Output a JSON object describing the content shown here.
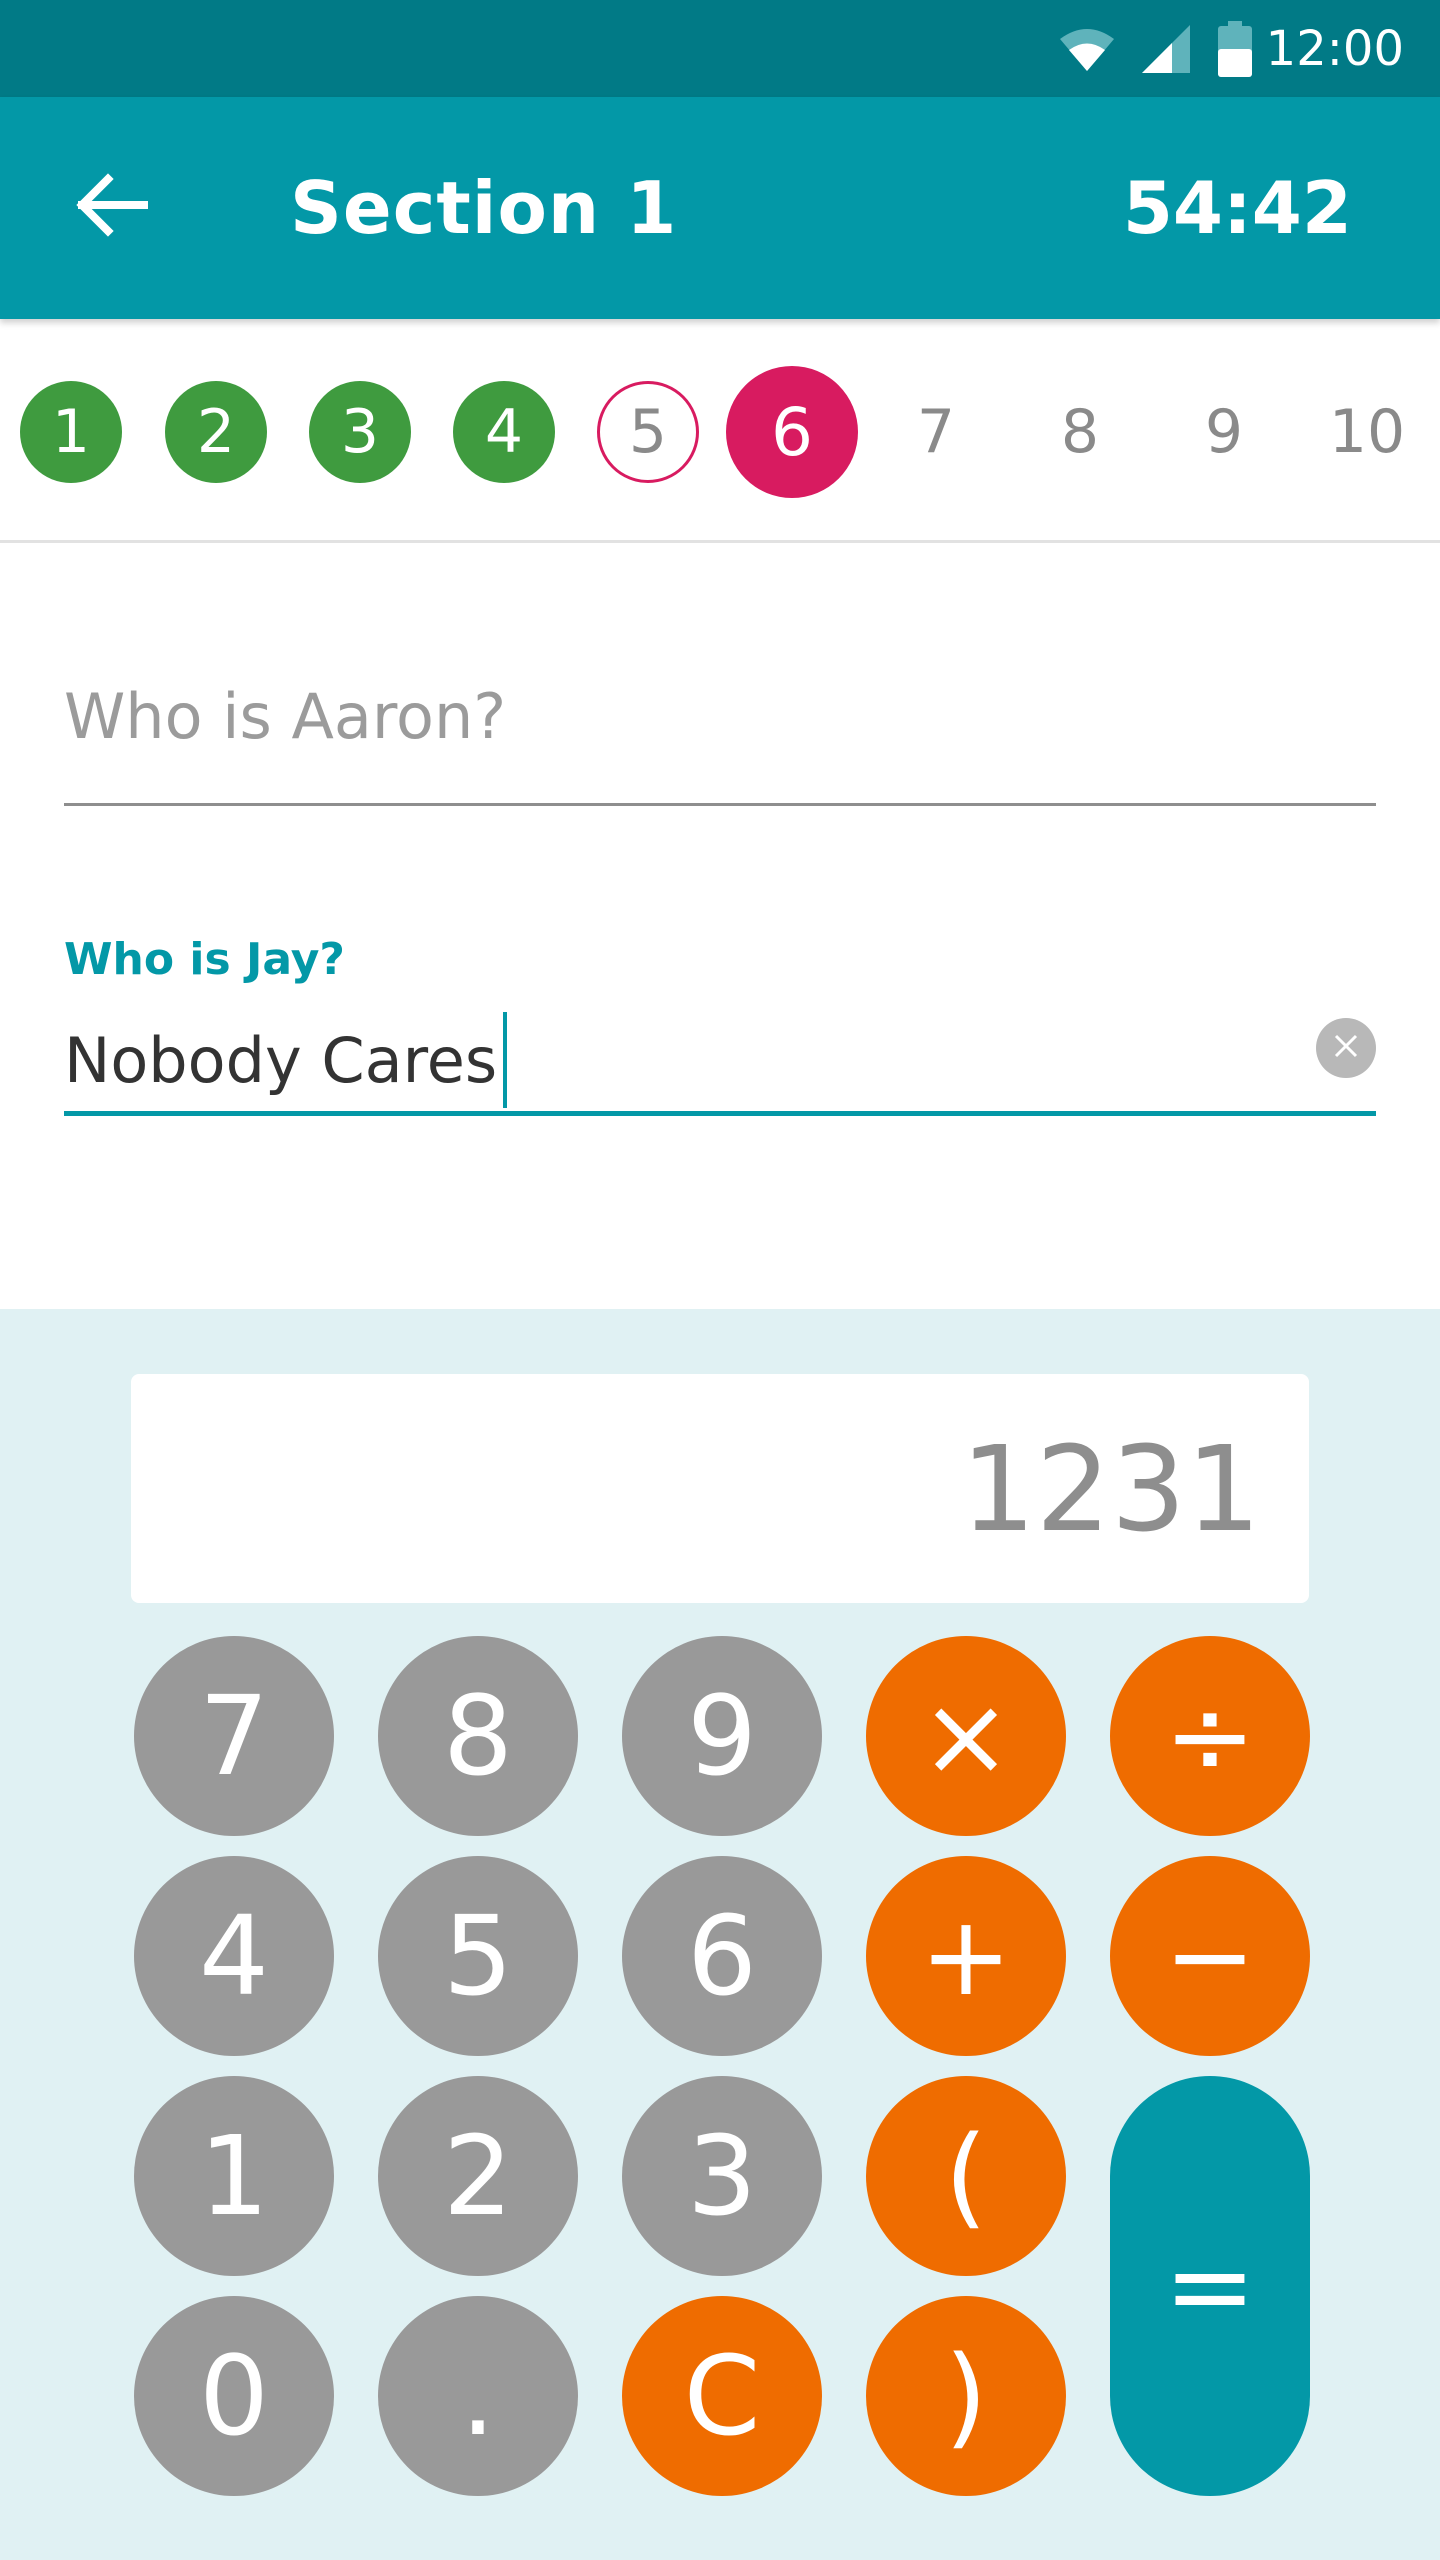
{
  "status_bar": {
    "time": "12:00",
    "icons": [
      "wifi-icon",
      "cell-signal-icon",
      "battery-icon"
    ]
  },
  "app_bar": {
    "back_icon": "arrow-left-icon",
    "title": "Section 1",
    "timer": "54:42"
  },
  "question_nav": {
    "items": [
      {
        "label": "1",
        "state": "answered"
      },
      {
        "label": "2",
        "state": "answered"
      },
      {
        "label": "3",
        "state": "answered"
      },
      {
        "label": "4",
        "state": "answered"
      },
      {
        "label": "5",
        "state": "flagged"
      },
      {
        "label": "6",
        "state": "current"
      },
      {
        "label": "7",
        "state": "unvisited"
      },
      {
        "label": "8",
        "state": "unvisited"
      },
      {
        "label": "9",
        "state": "unvisited"
      },
      {
        "label": "10",
        "state": "unvisited"
      }
    ]
  },
  "form": {
    "question1_placeholder": "Who is Aaron?",
    "question2_label": "Who is Jay?",
    "question2_value": "Nobody Cares",
    "clear_icon": "clear-circle-icon"
  },
  "calculator": {
    "display": "1231",
    "keys": {
      "k7": "7",
      "k8": "8",
      "k9": "9",
      "multiply": "×",
      "divide": "÷",
      "k4": "4",
      "k5": "5",
      "k6": "6",
      "plus": "+",
      "minus": "−",
      "k1": "1",
      "k2": "2",
      "k3": "3",
      "open_paren": "(",
      "k0": "0",
      "dot": ".",
      "clear": "C",
      "close_paren": ")",
      "equals": "="
    }
  },
  "colors": {
    "status_bar": "#017a86",
    "app_bar": "#0398a7",
    "answered": "#3f9b3f",
    "current": "#d81b60",
    "number_key": "#999999",
    "operator_key": "#ef6c00",
    "calc_background": "#e0f1f3"
  }
}
